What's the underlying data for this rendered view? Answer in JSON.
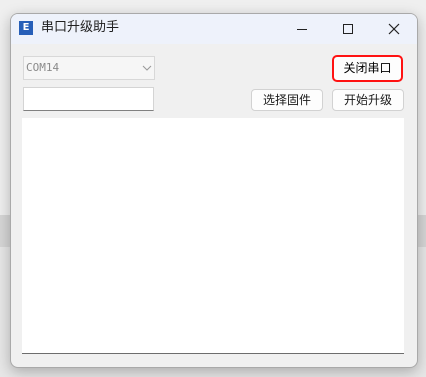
{
  "window": {
    "title": "串口升级助手",
    "icon_name": "app-logo-icon",
    "controls": {
      "minimize_icon": "minimize-icon",
      "maximize_icon": "maximize-icon",
      "close_icon": "close-icon"
    }
  },
  "serial": {
    "port_value": "COM14",
    "input_value": ""
  },
  "buttons": {
    "close_port": "关闭串口",
    "select_firmware": "选择固件",
    "start_upgrade": "开始升级"
  },
  "colors": {
    "highlight": "#ff1212",
    "icon_bg": "#275fb8"
  },
  "log": {
    "content": ""
  }
}
